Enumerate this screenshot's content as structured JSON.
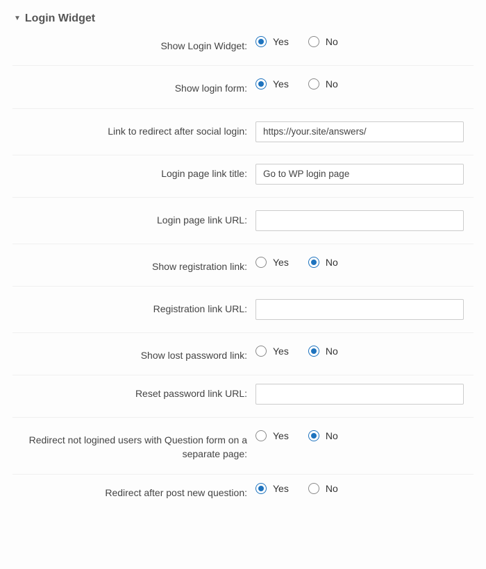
{
  "section": {
    "title": "Login Widget"
  },
  "options": {
    "yes": "Yes",
    "no": "No"
  },
  "fields": {
    "show_login_widget": {
      "label": "Show Login Widget:",
      "value": "yes"
    },
    "show_login_form": {
      "label": "Show login form:",
      "value": "yes"
    },
    "redirect_after_social": {
      "label": "Link to redirect after social login:",
      "value": "https://your.site/answers/"
    },
    "login_page_title": {
      "label": "Login page link title:",
      "value": "Go to WP login page"
    },
    "login_page_url": {
      "label": "Login page link URL:",
      "value": ""
    },
    "show_registration_link": {
      "label": "Show registration link:",
      "value": "no"
    },
    "registration_link_url": {
      "label": "Registration link URL:",
      "value": ""
    },
    "show_lost_password": {
      "label": "Show lost password link:",
      "value": "no"
    },
    "reset_password_url": {
      "label": "Reset password link URL:",
      "value": ""
    },
    "redirect_not_logged": {
      "label": "Redirect not logined users with Question form on a separate page:",
      "value": "no"
    },
    "redirect_after_post": {
      "label": "Redirect after post new question:",
      "value": "yes"
    }
  }
}
